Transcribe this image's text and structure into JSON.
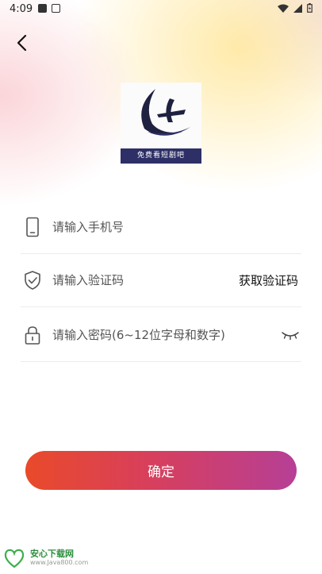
{
  "status_bar": {
    "time": "4:09"
  },
  "logo": {
    "caption": "免费看短剧吧"
  },
  "form": {
    "phone_placeholder": "请输入手机号",
    "code_placeholder": "请输入验证码",
    "get_code_label": "获取验证码",
    "password_placeholder": "请输入密码(6~12位字母和数字)"
  },
  "confirm_label": "确定",
  "watermark": {
    "title": "安心下载网",
    "url": "www.Java800.com"
  },
  "colors": {
    "button_start": "#e94a2a",
    "button_end": "#b63f96"
  }
}
